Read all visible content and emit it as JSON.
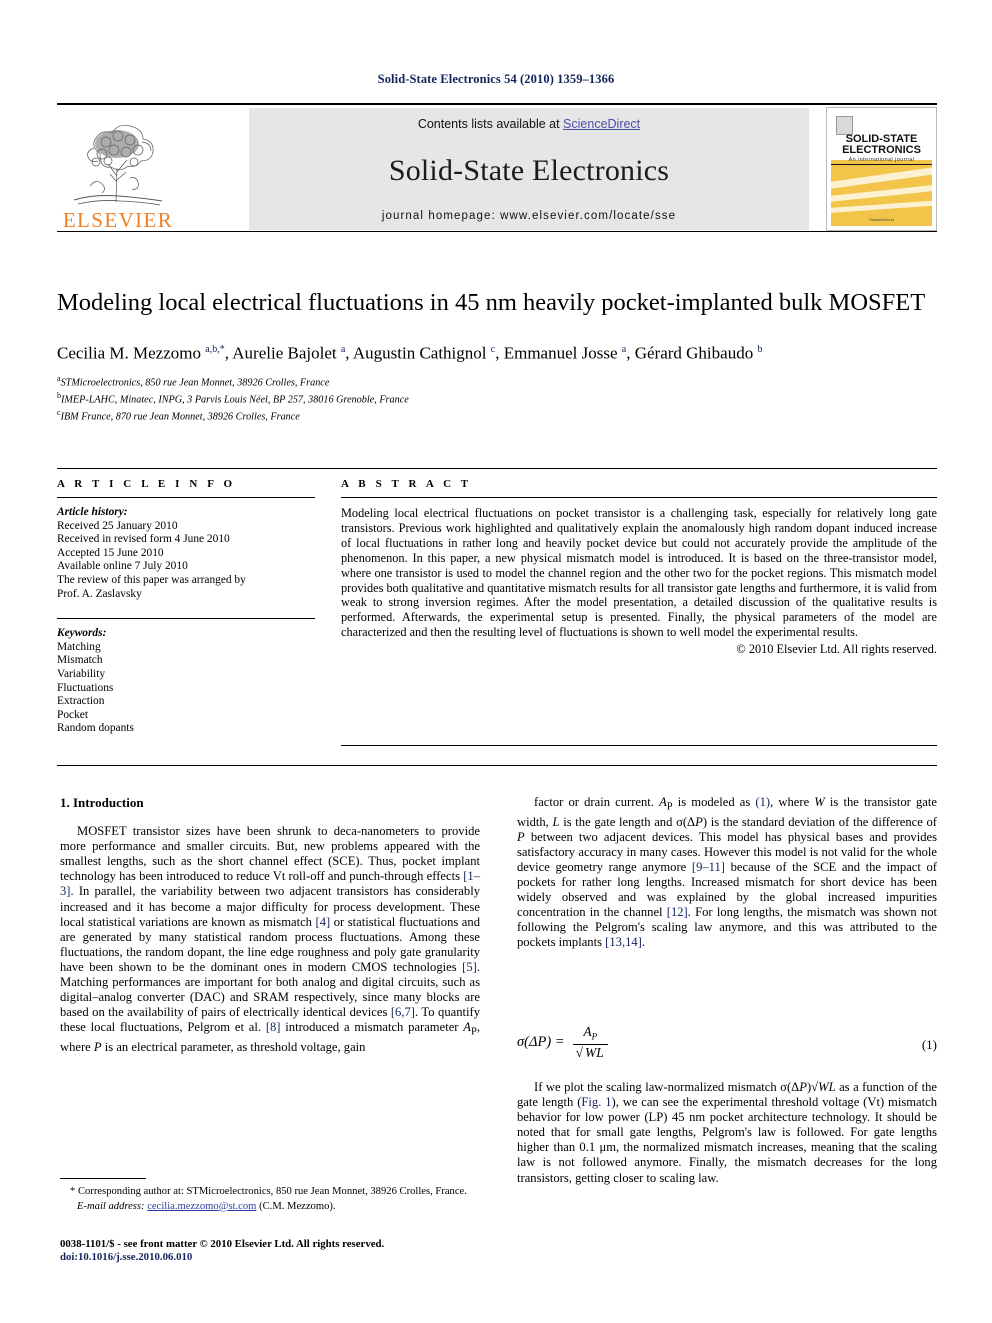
{
  "running_head": "Solid-State Electronics 54 (2010) 1359–1366",
  "masthead": {
    "contents_prefix": "Contents lists available at ",
    "sciencedirect": "ScienceDirect",
    "journal_title": "Solid-State Electronics",
    "homepage": "journal homepage: www.elsevier.com/locate/sse",
    "publisher_word": "ELSEVIER",
    "cover": {
      "line1": "SOLID-STATE",
      "line2": "ELECTRONICS",
      "subtitle": "An international journal",
      "footer": "ScienceDirect"
    },
    "link_color": "#4a4fa6",
    "publisher_color": "#ef7f22",
    "panel_color": "#e6e6e6",
    "cover_color": "#f2c54a"
  },
  "article": {
    "title": "Modeling local electrical fluctuations in 45 nm heavily pocket-implanted bulk MOSFET",
    "authors_html": "Cecilia M. Mezzomo <sup>a,b,*</sup>, Aurelie Bajolet <sup>a</sup>, Augustin Cathignol <sup>c</sup>, Emmanuel Josse <sup>a</sup>, Gérard Ghibaudo <sup>b</sup>",
    "affiliations": [
      {
        "marker": "a",
        "text": "STMicroelectronics, 850 rue Jean Monnet, 38926 Crolles, France"
      },
      {
        "marker": "b",
        "text": "IMEP-LAHC, Minatec, INPG, 3 Parvis Louis Néel, BP 257, 38016 Grenoble, France"
      },
      {
        "marker": "c",
        "text": "IBM France, 870 rue Jean Monnet, 38926 Crolles, France"
      }
    ]
  },
  "article_info": {
    "heading": "A R T I C L E   I N F O",
    "history_label": "Article history:",
    "history": [
      "Received 25 January 2010",
      "Received in revised form 4 June 2010",
      "Accepted 15 June 2010",
      "Available online 7 July 2010",
      "The review of this paper was arranged by",
      "Prof. A. Zaslavsky"
    ],
    "keywords_label": "Keywords:",
    "keywords": [
      "Matching",
      "Mismatch",
      "Variability",
      "Fluctuations",
      "Extraction",
      "Pocket",
      "Random dopants"
    ]
  },
  "abstract": {
    "heading": "A B S T R A C T",
    "text": "Modeling local electrical fluctuations on pocket transistor is a challenging task, especially for relatively long gate transistors. Previous work highlighted and qualitatively explain the anomalously high random dopant induced increase of local fluctuations in rather long and heavily pocket device but could not accurately provide the amplitude of the phenomenon. In this paper, a new physical mismatch model is introduced. It is based on the three-transistor model, where one transistor is used to model the channel region and the other two for the pocket regions. This mismatch model provides both qualitative and quantitative mismatch results for all transistor gate lengths and furthermore, it is valid from weak to strong inversion regimes. After the model presentation, a detailed discussion of the qualitative results is performed. Afterwards, the experimental setup is presented. Finally, the physical parameters of the model are characterized and then the resulting level of fluctuations is shown to well model the experimental results.",
    "copyright": "© 2010 Elsevier Ltd. All rights reserved."
  },
  "body": {
    "section1_heading": "1. Introduction",
    "left_para1_html": "MOSFET transistor sizes have been shrunk to deca-nanometers to provide more performance and smaller circuits. But, new problems appeared with the smallest lengths, such as the short channel effect (SCE). Thus, pocket implant technology has been introduced to reduce Vt roll-off and punch-through effects <span class=\"ref\">[1–3]</span>. In parallel, the variability between two adjacent transistors has considerably increased and it has become a major difficulty for process development. These local statistical variations are known as mismatch <span class=\"ref\">[4]</span> or statistical fluctuations and are generated by many statistical random process fluctuations. Among these fluctuations, the random dopant, the line edge roughness and poly gate granularity have been shown to be the dominant ones in modern CMOS technologies <span class=\"ref\">[5]</span>. Matching performances are important for both analog and digital circuits, such as digital–analog converter (DAC) and SRAM respectively, since many blocks are based on the availability of pairs of electrically identical devices <span class=\"ref\">[6,7]</span>. To quantify these local fluctuations, Pelgrom et al. <span class=\"ref\">[8]</span> introduced a mismatch parameter <span class=\"ital\">A</span><sub>P</sub>, where <span class=\"ital\">P</span> is an electrical parameter, as threshold voltage, gain",
    "right_para1_html": "factor or drain current. <span class=\"ital\">A</span><sub>P</sub> is modeled as <span class=\"ref\">(1)</span>, where <span class=\"ital\">W</span> is the transistor gate width, <span class=\"ital\">L</span> is the gate length and σ(Δ<span class=\"ital\">P</span>) is the standard deviation of the difference of <span class=\"ital\">P</span> between two adjacent devices. This model has physical bases and provides satisfactory accuracy in many cases. However this model is not valid for the whole device geometry range anymore <span class=\"ref\">[9–11]</span> because of the SCE and the impact of pockets for rather long lengths. Increased mismatch for short device has been widely observed and was explained by the global increased impurities concentration in the channel <span class=\"ref\">[12]</span>. For long lengths, the mismatch was shown not following the Pelgrom's scaling law anymore, and this was attributed to the pockets implants <span class=\"ref\">[13,14]</span>.",
    "right_para2_html": "If we plot the scaling law-normalized mismatch σ(Δ<span class=\"ital\">P</span>)√<span class=\"ital\">WL</span> as a function of the gate length (<span class=\"ref\">Fig. 1</span>), we can see the experimental threshold voltage (Vt) mismatch behavior for low power (LP) 45 nm pocket architecture technology. It should be noted that for small gate lengths, Pelgrom's law is followed. For gate lengths higher than 0.1 μm, the normalized mismatch increases, meaning that the scaling law is not followed anymore. Finally, the mismatch decreases for the long transistors, getting closer to scaling law.",
    "equation": {
      "lhs": "σ(ΔP) =",
      "numerator": "A",
      "numerator_sub": "P",
      "denominator": "WL",
      "number": "(1)"
    }
  },
  "footnote": {
    "corresponding": "* Corresponding author at: STMicroelectronics, 850 rue Jean Monnet, 38926 Crolles, France.",
    "email_label": "E-mail address:",
    "email": "cecilia.mezzomo@st.com",
    "email_owner": "(C.M. Mezzomo)."
  },
  "imprint": {
    "issn_line": "0038-1101/$ - see front matter © 2010 Elsevier Ltd. All rights reserved.",
    "doi": "doi:10.1016/j.sse.2010.06.010"
  }
}
